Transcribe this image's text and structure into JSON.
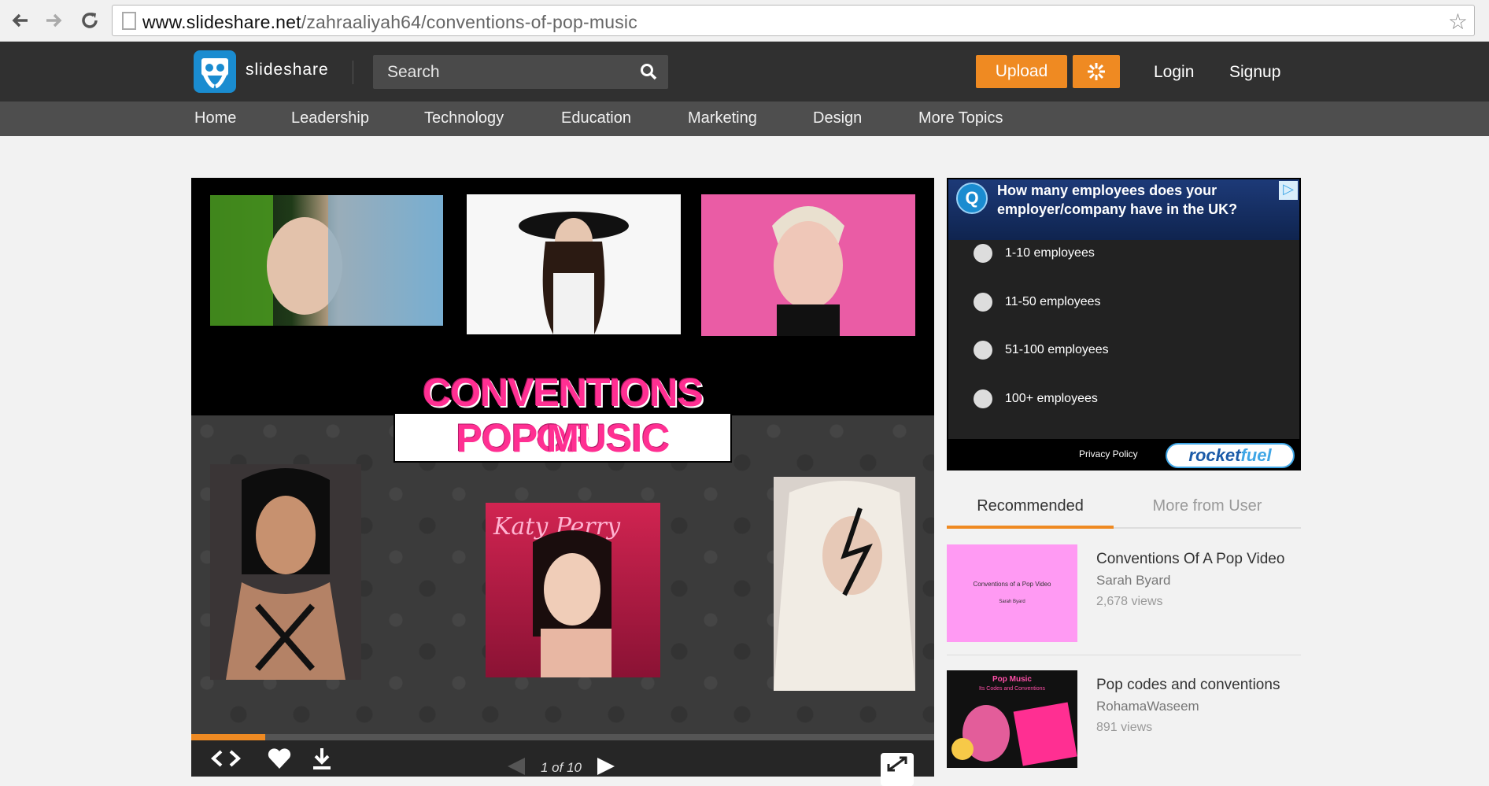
{
  "browser": {
    "url_host": "www.slideshare.net",
    "url_path": "/zahraaliyah64/conventions-of-pop-music",
    "back_icon": "back-arrow-icon",
    "forward_icon": "forward-arrow-icon",
    "reload_icon": "reload-icon",
    "star_icon": "star-icon"
  },
  "header": {
    "logo_text": "slideshare",
    "search_placeholder": "Search",
    "upload_label": "Upload",
    "login_label": "Login",
    "signup_label": "Signup"
  },
  "categories": [
    "Home",
    "Leadership",
    "Technology",
    "Education",
    "Marketing",
    "Design",
    "More Topics"
  ],
  "slide": {
    "title_line1": "CONVENTIONS OF",
    "title_line2": "POP MUSIC",
    "page_counter": "1 of 10",
    "progress": 0.1
  },
  "ad": {
    "question": "How many employees does your employer/company have in the UK?",
    "options": [
      "1-10 employees",
      "11-50 employees",
      "51-100 employees",
      "100+ employees"
    ],
    "privacy": "Privacy Policy",
    "brand_part1": "rocket",
    "brand_part2": "fuel"
  },
  "tabs": {
    "recommended": "Recommended",
    "more_from_user": "More from User"
  },
  "recommended": [
    {
      "title": "Conventions Of A Pop Video",
      "author": "Sarah Byard",
      "views": "2,678 views",
      "thumb_title": "Conventions of a Pop Video",
      "thumb_sub": "Sarah Byard"
    },
    {
      "title": "Pop codes and conventions",
      "author": "RohamaWaseem",
      "views": "891 views",
      "thumb_title": "Pop Music",
      "thumb_sub": "Its Codes and Conventions"
    }
  ],
  "colors": {
    "accent": "#ef8a22",
    "header_bg": "#303030",
    "nav_bg": "#4e4e4e",
    "logo_blue": "#1a8cd0",
    "title_pink": "#ff2f92"
  }
}
